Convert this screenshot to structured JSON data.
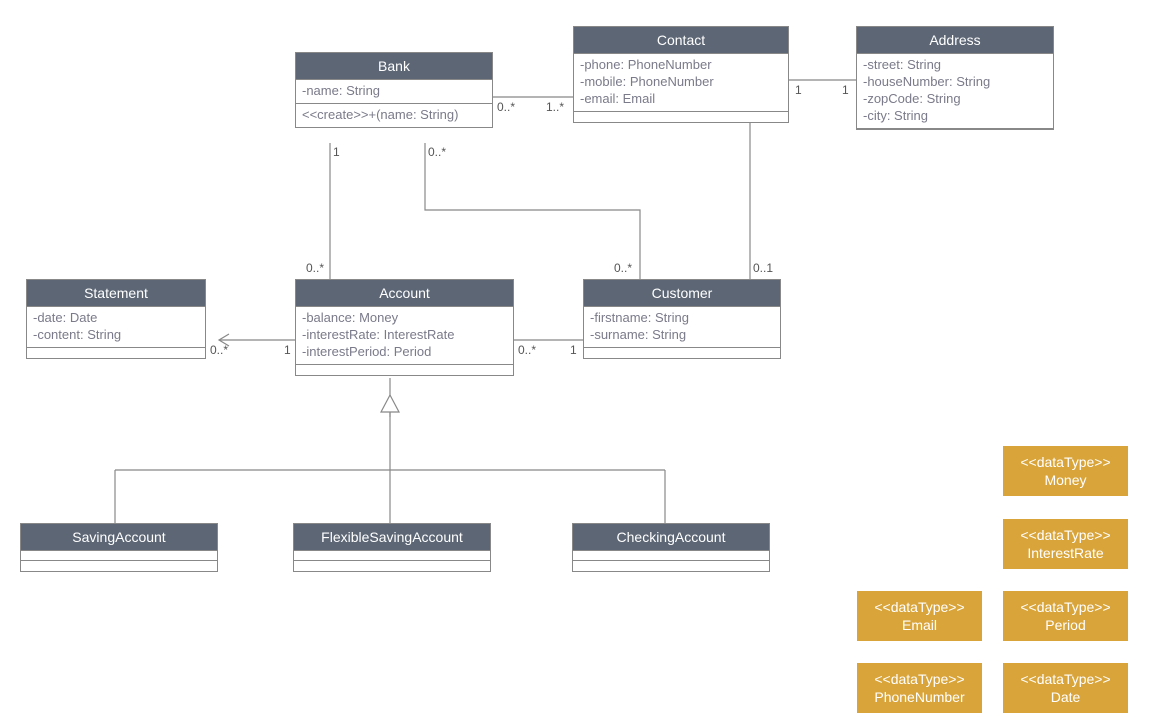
{
  "classes": {
    "bank": {
      "name": "Bank",
      "attrs": [
        "-name: String"
      ],
      "ops": [
        "<<create>>+(name: String)"
      ]
    },
    "contact": {
      "name": "Contact",
      "attrs": [
        "-phone: PhoneNumber",
        "-mobile: PhoneNumber",
        "-email: Email"
      ],
      "ops": []
    },
    "address": {
      "name": "Address",
      "attrs": [
        "-street: String",
        "-houseNumber: String",
        "-zopCode: String",
        "-city: String"
      ],
      "ops": []
    },
    "statement": {
      "name": "Statement",
      "attrs": [
        "-date: Date",
        "-content: String"
      ],
      "ops": []
    },
    "account": {
      "name": "Account",
      "attrs": [
        "-balance: Money",
        "-interestRate: InterestRate",
        "-interestPeriod: Period"
      ],
      "ops": []
    },
    "customer": {
      "name": "Customer",
      "attrs": [
        "-firstname: String",
        "-surname: String"
      ],
      "ops": []
    },
    "saving": {
      "name": "SavingAccount",
      "attrs": [],
      "ops": []
    },
    "flexible": {
      "name": "FlexibleSavingAccount",
      "attrs": [],
      "ops": []
    },
    "checking": {
      "name": "CheckingAccount",
      "attrs": [],
      "ops": []
    }
  },
  "datatypes": {
    "money": {
      "stereotype": "<<dataType>>",
      "name": "Money"
    },
    "interest": {
      "stereotype": "<<dataType>>",
      "name": "InterestRate"
    },
    "email": {
      "stereotype": "<<dataType>>",
      "name": "Email"
    },
    "period": {
      "stereotype": "<<dataType>>",
      "name": "Period"
    },
    "phone": {
      "stereotype": "<<dataType>>",
      "name": "PhoneNumber"
    },
    "date": {
      "stereotype": "<<dataType>>",
      "name": "Date"
    }
  },
  "mults": {
    "bank_contact_l": "0..*",
    "bank_contact_r": "1..*",
    "contact_address_l": "1",
    "contact_address_r": "1",
    "bank_account_t": "1",
    "bank_account_b": "0..*",
    "bank_customer_t": "0..*",
    "bank_customer_b": "0..*",
    "contact_customer_b": "0..1",
    "account_customer_l": "0..*",
    "account_customer_r": "1",
    "account_statement_l": "0..*",
    "account_statement_r": "1"
  }
}
